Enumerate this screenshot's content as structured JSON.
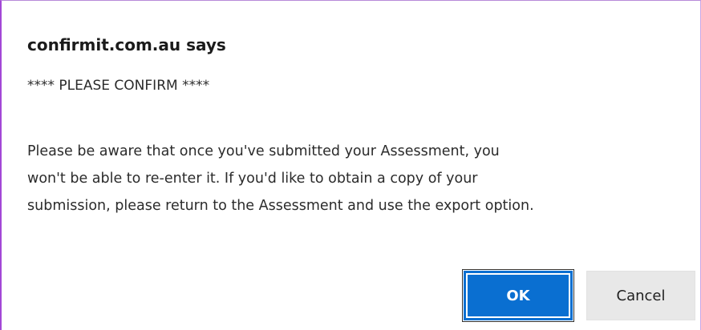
{
  "dialog": {
    "title": "confirmit.com.au says",
    "heading_line": "**** PLEASE CONFIRM ****",
    "body_lines": [
      "Please be aware that once you've submitted your Assessment, you",
      "won't be able to re-enter it. If you'd like to obtain a copy of your",
      "submission, please return to the Assessment and use the export option."
    ],
    "ok_label": "OK",
    "cancel_label": "Cancel"
  },
  "colors": {
    "accent_border": "#a347d6",
    "ok_button": "#0a6fd1",
    "cancel_button": "#e8e8e8"
  }
}
